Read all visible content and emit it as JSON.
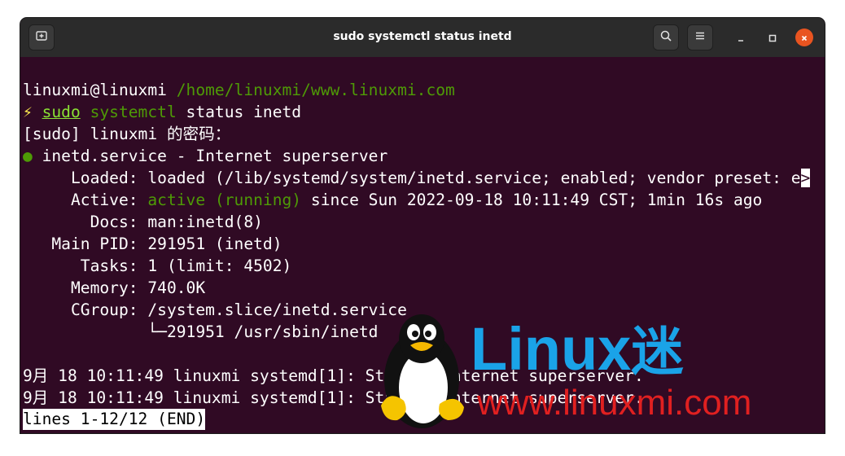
{
  "window": {
    "title": "sudo systemctl status inetd",
    "icons": {
      "new_tab": "new-tab-icon",
      "search": "search-icon",
      "menu": "hamburger-menu-icon",
      "minimize": "minimize-icon",
      "maximize": "maximize-icon",
      "close": "close-icon"
    },
    "colors": {
      "terminal_bg": "#300a24",
      "titlebar_bg": "#2b2b2b",
      "close": "#e95420"
    }
  },
  "terminal": {
    "prompt": {
      "user_host": "linuxmi@linuxmi",
      "path": "/home/linuxmi/www.linuxmi.com"
    },
    "command": {
      "bolt": "⚡",
      "sudo": "sudo",
      "systemctl": "systemctl",
      "args": "status inetd"
    },
    "sudo_prompt": "[sudo] linuxmi 的密码：",
    "service_header": {
      "dot": "●",
      "text": "inetd.service - Internet superserver"
    },
    "fields": {
      "loaded_label": "Loaded:",
      "loaded_value": "loaded (/lib/systemd/system/inetd.service; enabled; vendor preset: e",
      "loaded_overflow": ">",
      "active_label": "Active:",
      "active_state": "active (running)",
      "active_since": "since Sun 2022-09-18 10:11:49 CST; 1min 16s ago",
      "docs_label": "Docs:",
      "docs_value": "man:inetd(8)",
      "pid_label": "Main PID:",
      "pid_value": "291951 (inetd)",
      "tasks_label": "Tasks:",
      "tasks_value": "1 (limit: 4502)",
      "memory_label": "Memory:",
      "memory_value": "740.0K",
      "cgroup_label": "CGroup:",
      "cgroup_value": "/system.slice/inetd.service",
      "cgroup_child": "└─291951 /usr/sbin/inetd"
    },
    "log": [
      "9月 18 10:11:49 linuxmi systemd[1]: Started Internet superserver.",
      "9月 18 10:11:49 linuxmi systemd[1]: Started Internet superserver."
    ],
    "pager_status": "lines 1-12/12 (END)"
  },
  "watermark": {
    "brand": "Linux",
    "brand_cn": "迷",
    "url": "www.linuxmi.com",
    "colors": {
      "brand": "#1aa3e8",
      "url": "#e02020"
    }
  }
}
